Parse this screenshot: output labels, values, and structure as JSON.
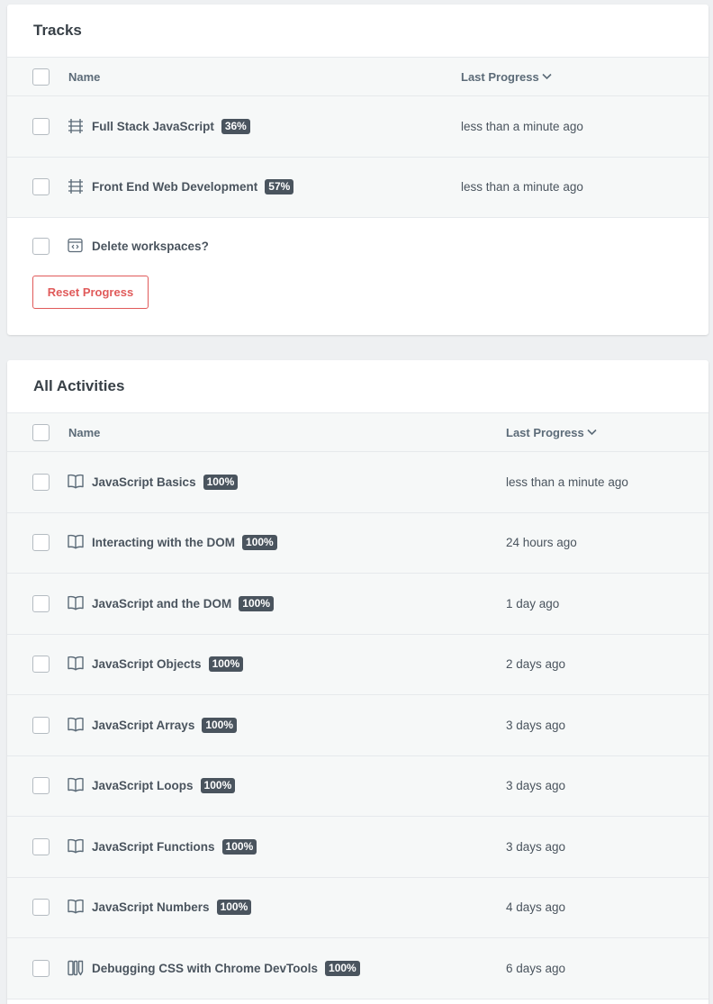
{
  "tracks": {
    "title": "Tracks",
    "columns": {
      "name": "Name",
      "progress": "Last Progress"
    },
    "rows": [
      {
        "name": "Full Stack JavaScript",
        "percent": "36%",
        "time": "less than a minute ago",
        "icon": "track-icon"
      },
      {
        "name": "Front End Web Development",
        "percent": "57%",
        "time": "less than a minute ago",
        "icon": "track-icon"
      }
    ],
    "workspaces_label": "Delete workspaces?",
    "reset_label": "Reset Progress"
  },
  "activities": {
    "title": "All Activities",
    "columns": {
      "name": "Name",
      "progress": "Last Progress"
    },
    "rows": [
      {
        "name": "JavaScript Basics",
        "percent": "100%",
        "time": "less than a minute ago",
        "icon": "book-icon"
      },
      {
        "name": "Interacting with the DOM",
        "percent": "100%",
        "time": "24 hours ago",
        "icon": "book-icon"
      },
      {
        "name": "JavaScript and the DOM",
        "percent": "100%",
        "time": "1 day ago",
        "icon": "book-icon"
      },
      {
        "name": "JavaScript Objects",
        "percent": "100%",
        "time": "2 days ago",
        "icon": "book-icon"
      },
      {
        "name": "JavaScript Arrays",
        "percent": "100%",
        "time": "3 days ago",
        "icon": "book-icon"
      },
      {
        "name": "JavaScript Loops",
        "percent": "100%",
        "time": "3 days ago",
        "icon": "book-icon"
      },
      {
        "name": "JavaScript Functions",
        "percent": "100%",
        "time": "3 days ago",
        "icon": "book-icon"
      },
      {
        "name": "JavaScript Numbers",
        "percent": "100%",
        "time": "4 days ago",
        "icon": "book-icon"
      },
      {
        "name": "Debugging CSS with Chrome DevTools",
        "percent": "100%",
        "time": "6 days ago",
        "icon": "workshop-icon"
      }
    ]
  },
  "colors": {
    "danger": "#e05a5a",
    "badge_bg": "#4a545e",
    "row_bg": "#f6f8f8",
    "page_bg": "#eef0f2"
  }
}
